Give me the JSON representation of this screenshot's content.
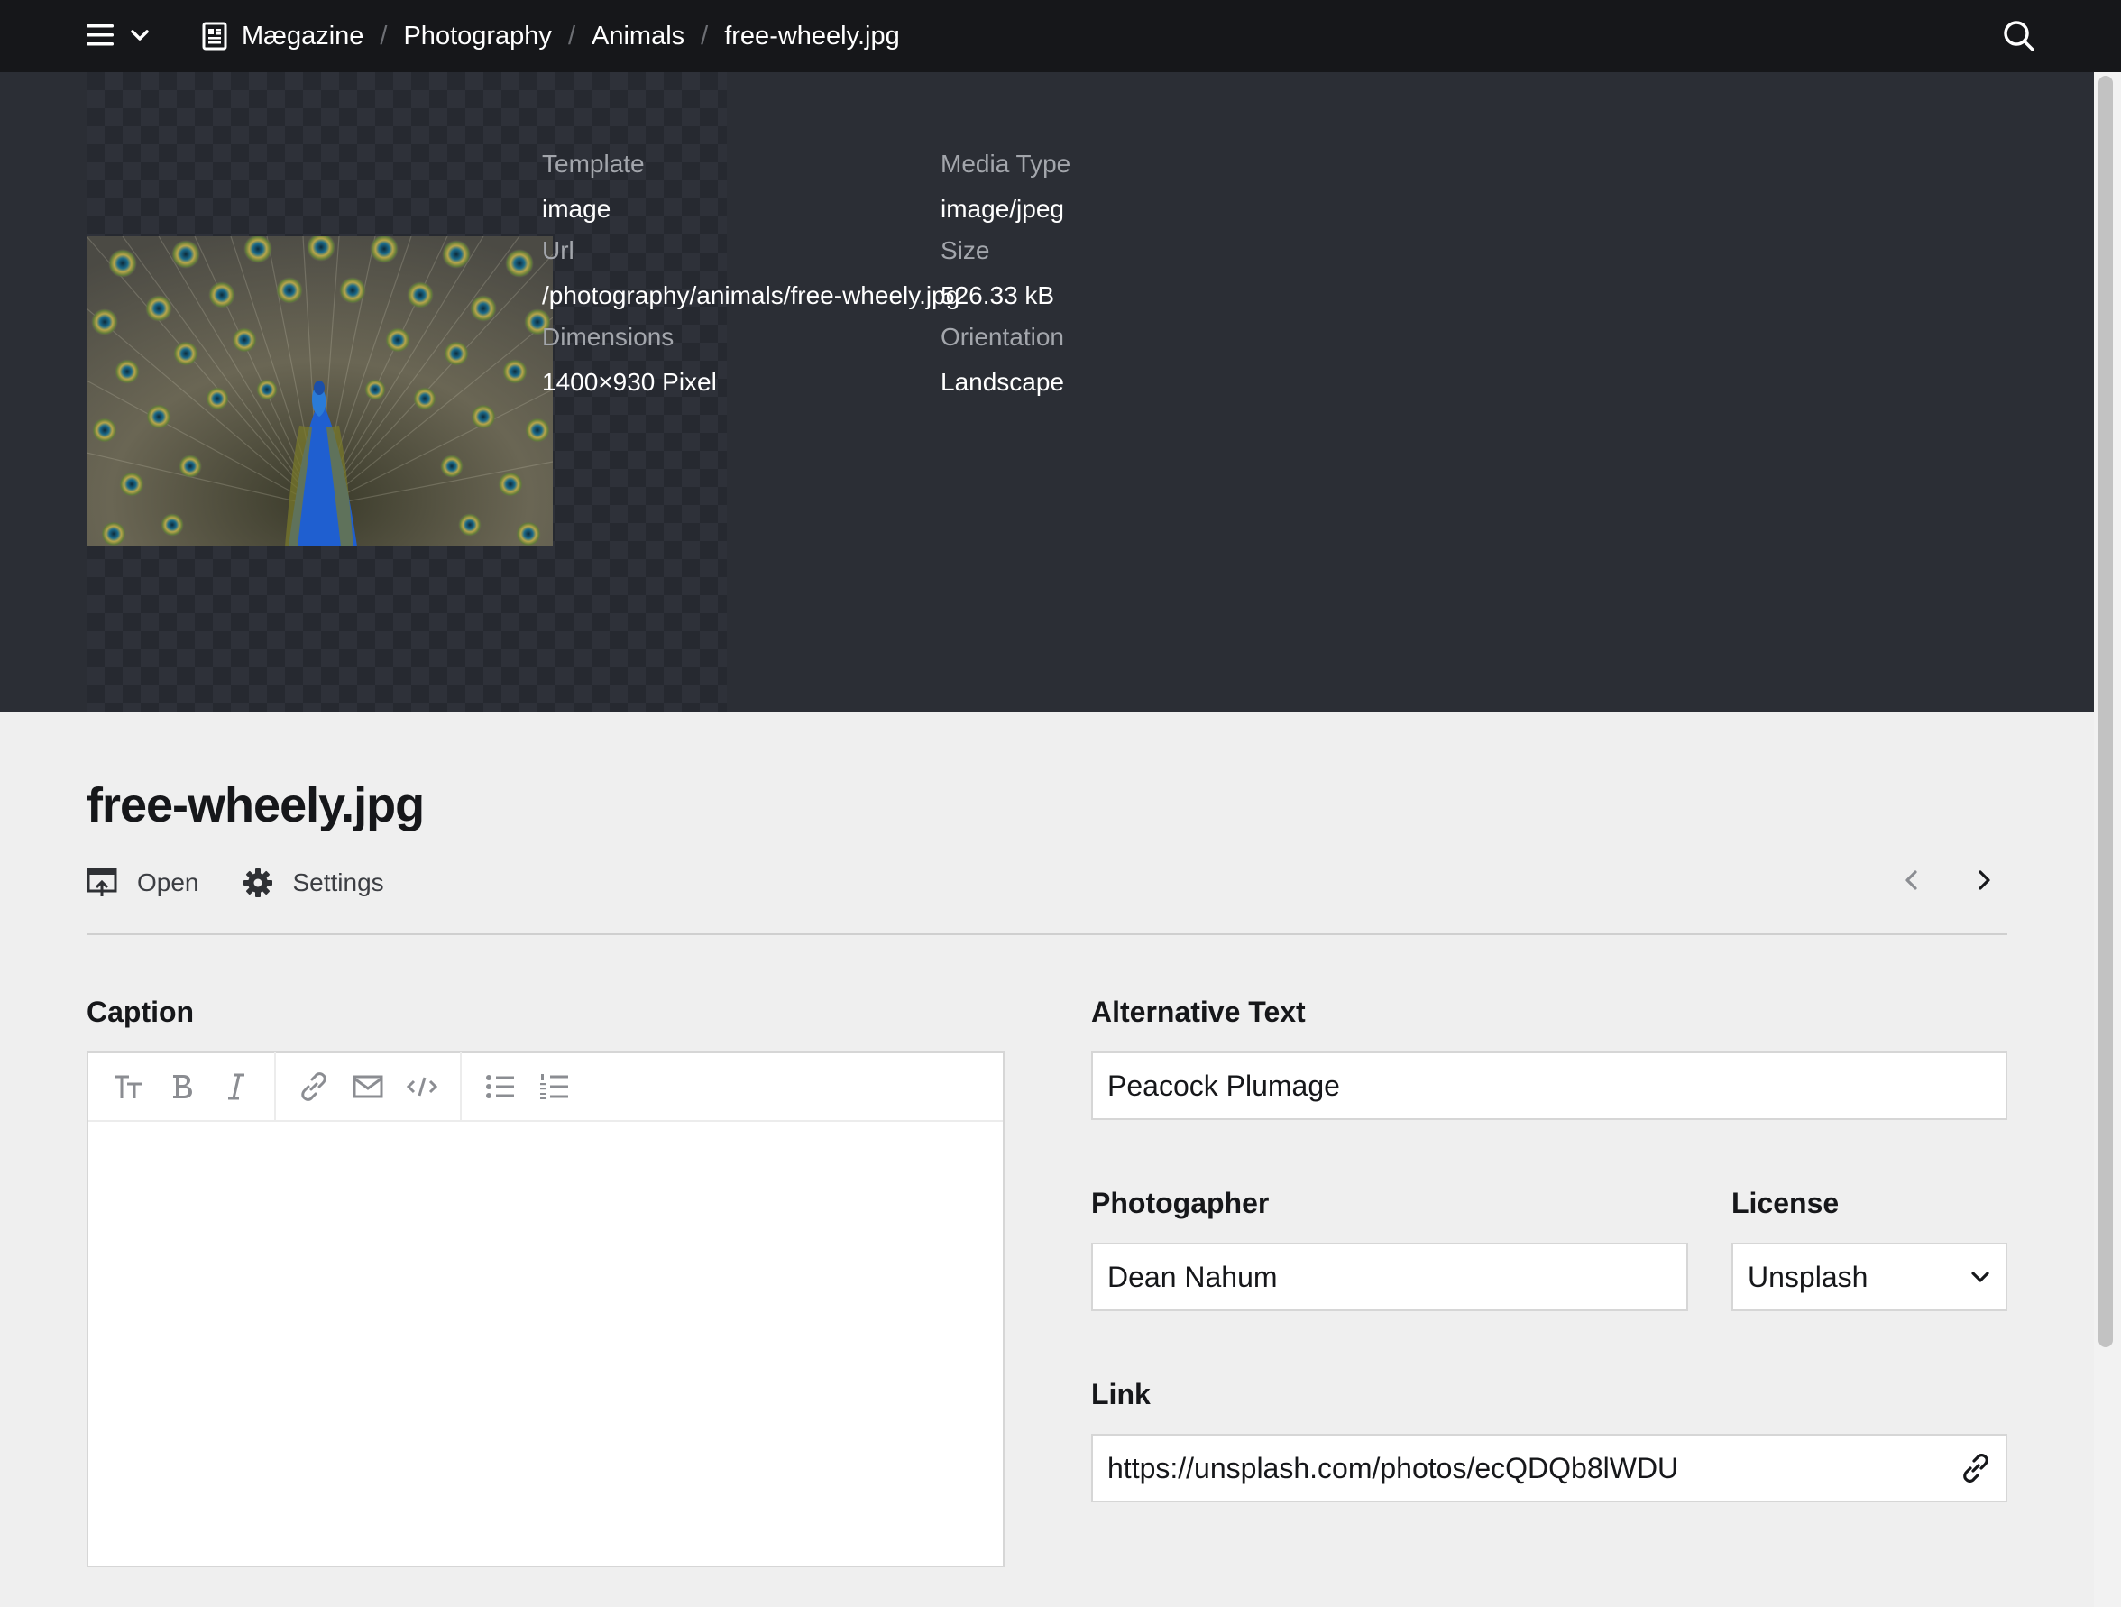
{
  "breadcrumb": [
    {
      "label": "Mægazine",
      "icon": "page-icon"
    },
    {
      "label": "Photography"
    },
    {
      "label": "Animals"
    },
    {
      "label": "free-wheely.jpg"
    }
  ],
  "preview": {
    "image_alt": "Peacock with fanned tail feathers",
    "meta": {
      "template": {
        "label": "Template",
        "value": "image"
      },
      "media_type": {
        "label": "Media Type",
        "value": "image/jpeg"
      },
      "url": {
        "label": "Url",
        "value": "/photography/animals/free-wheely.jpg"
      },
      "size": {
        "label": "Size",
        "value": "526.33 kB"
      },
      "dimensions": {
        "label": "Dimensions",
        "value": "1400×930 Pixel"
      },
      "orientation": {
        "label": "Orientation",
        "value": "Landscape"
      }
    }
  },
  "page": {
    "title": "free-wheely.jpg",
    "actions": {
      "open": "Open",
      "settings": "Settings"
    }
  },
  "fields": {
    "caption": {
      "label": "Caption",
      "value": ""
    },
    "alt_text": {
      "label": "Alternative Text",
      "value": "Peacock Plumage"
    },
    "photographer": {
      "label": "Photogapher",
      "value": "Dean Nahum"
    },
    "license": {
      "label": "License",
      "value": "Unsplash"
    },
    "link": {
      "label": "Link",
      "value": "https://unsplash.com/photos/ecQDQb8lWDU"
    }
  },
  "toolbar": {
    "buttons": [
      "headings-icon",
      "bold-icon",
      "italic-icon",
      "link-icon",
      "email-icon",
      "code-icon",
      "bullet-list-icon",
      "numbered-list-icon"
    ]
  },
  "colors": {
    "topbar": "#16171a",
    "preview_band": "#2b2e35",
    "page_bg": "#efefef"
  }
}
